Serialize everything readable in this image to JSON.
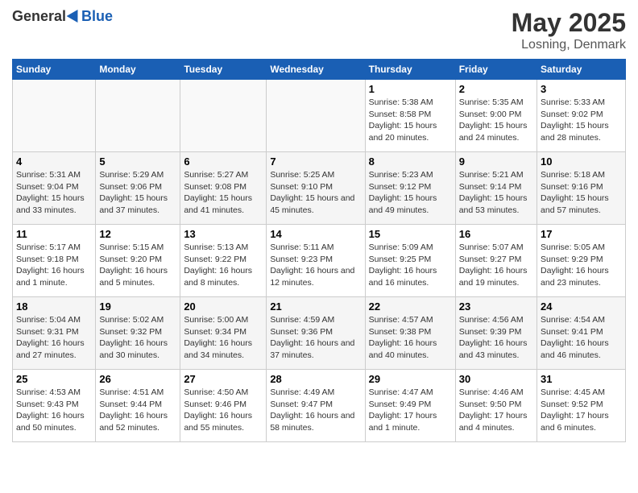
{
  "header": {
    "logo_general": "General",
    "logo_blue": "Blue",
    "title": "May 2025",
    "subtitle": "Losning, Denmark"
  },
  "calendar": {
    "days_of_week": [
      "Sunday",
      "Monday",
      "Tuesday",
      "Wednesday",
      "Thursday",
      "Friday",
      "Saturday"
    ],
    "weeks": [
      [
        {
          "day": "",
          "content": ""
        },
        {
          "day": "",
          "content": ""
        },
        {
          "day": "",
          "content": ""
        },
        {
          "day": "",
          "content": ""
        },
        {
          "day": "1",
          "content": "Sunrise: 5:38 AM\nSunset: 8:58 PM\nDaylight: 15 hours\nand 20 minutes."
        },
        {
          "day": "2",
          "content": "Sunrise: 5:35 AM\nSunset: 9:00 PM\nDaylight: 15 hours\nand 24 minutes."
        },
        {
          "day": "3",
          "content": "Sunrise: 5:33 AM\nSunset: 9:02 PM\nDaylight: 15 hours\nand 28 minutes."
        }
      ],
      [
        {
          "day": "4",
          "content": "Sunrise: 5:31 AM\nSunset: 9:04 PM\nDaylight: 15 hours\nand 33 minutes."
        },
        {
          "day": "5",
          "content": "Sunrise: 5:29 AM\nSunset: 9:06 PM\nDaylight: 15 hours\nand 37 minutes."
        },
        {
          "day": "6",
          "content": "Sunrise: 5:27 AM\nSunset: 9:08 PM\nDaylight: 15 hours\nand 41 minutes."
        },
        {
          "day": "7",
          "content": "Sunrise: 5:25 AM\nSunset: 9:10 PM\nDaylight: 15 hours\nand 45 minutes."
        },
        {
          "day": "8",
          "content": "Sunrise: 5:23 AM\nSunset: 9:12 PM\nDaylight: 15 hours\nand 49 minutes."
        },
        {
          "day": "9",
          "content": "Sunrise: 5:21 AM\nSunset: 9:14 PM\nDaylight: 15 hours\nand 53 minutes."
        },
        {
          "day": "10",
          "content": "Sunrise: 5:18 AM\nSunset: 9:16 PM\nDaylight: 15 hours\nand 57 minutes."
        }
      ],
      [
        {
          "day": "11",
          "content": "Sunrise: 5:17 AM\nSunset: 9:18 PM\nDaylight: 16 hours\nand 1 minute."
        },
        {
          "day": "12",
          "content": "Sunrise: 5:15 AM\nSunset: 9:20 PM\nDaylight: 16 hours\nand 5 minutes."
        },
        {
          "day": "13",
          "content": "Sunrise: 5:13 AM\nSunset: 9:22 PM\nDaylight: 16 hours\nand 8 minutes."
        },
        {
          "day": "14",
          "content": "Sunrise: 5:11 AM\nSunset: 9:23 PM\nDaylight: 16 hours\nand 12 minutes."
        },
        {
          "day": "15",
          "content": "Sunrise: 5:09 AM\nSunset: 9:25 PM\nDaylight: 16 hours\nand 16 minutes."
        },
        {
          "day": "16",
          "content": "Sunrise: 5:07 AM\nSunset: 9:27 PM\nDaylight: 16 hours\nand 19 minutes."
        },
        {
          "day": "17",
          "content": "Sunrise: 5:05 AM\nSunset: 9:29 PM\nDaylight: 16 hours\nand 23 minutes."
        }
      ],
      [
        {
          "day": "18",
          "content": "Sunrise: 5:04 AM\nSunset: 9:31 PM\nDaylight: 16 hours\nand 27 minutes."
        },
        {
          "day": "19",
          "content": "Sunrise: 5:02 AM\nSunset: 9:32 PM\nDaylight: 16 hours\nand 30 minutes."
        },
        {
          "day": "20",
          "content": "Sunrise: 5:00 AM\nSunset: 9:34 PM\nDaylight: 16 hours\nand 34 minutes."
        },
        {
          "day": "21",
          "content": "Sunrise: 4:59 AM\nSunset: 9:36 PM\nDaylight: 16 hours\nand 37 minutes."
        },
        {
          "day": "22",
          "content": "Sunrise: 4:57 AM\nSunset: 9:38 PM\nDaylight: 16 hours\nand 40 minutes."
        },
        {
          "day": "23",
          "content": "Sunrise: 4:56 AM\nSunset: 9:39 PM\nDaylight: 16 hours\nand 43 minutes."
        },
        {
          "day": "24",
          "content": "Sunrise: 4:54 AM\nSunset: 9:41 PM\nDaylight: 16 hours\nand 46 minutes."
        }
      ],
      [
        {
          "day": "25",
          "content": "Sunrise: 4:53 AM\nSunset: 9:43 PM\nDaylight: 16 hours\nand 50 minutes."
        },
        {
          "day": "26",
          "content": "Sunrise: 4:51 AM\nSunset: 9:44 PM\nDaylight: 16 hours\nand 52 minutes."
        },
        {
          "day": "27",
          "content": "Sunrise: 4:50 AM\nSunset: 9:46 PM\nDaylight: 16 hours\nand 55 minutes."
        },
        {
          "day": "28",
          "content": "Sunrise: 4:49 AM\nSunset: 9:47 PM\nDaylight: 16 hours\nand 58 minutes."
        },
        {
          "day": "29",
          "content": "Sunrise: 4:47 AM\nSunset: 9:49 PM\nDaylight: 17 hours\nand 1 minute."
        },
        {
          "day": "30",
          "content": "Sunrise: 4:46 AM\nSunset: 9:50 PM\nDaylight: 17 hours\nand 4 minutes."
        },
        {
          "day": "31",
          "content": "Sunrise: 4:45 AM\nSunset: 9:52 PM\nDaylight: 17 hours\nand 6 minutes."
        }
      ]
    ]
  }
}
